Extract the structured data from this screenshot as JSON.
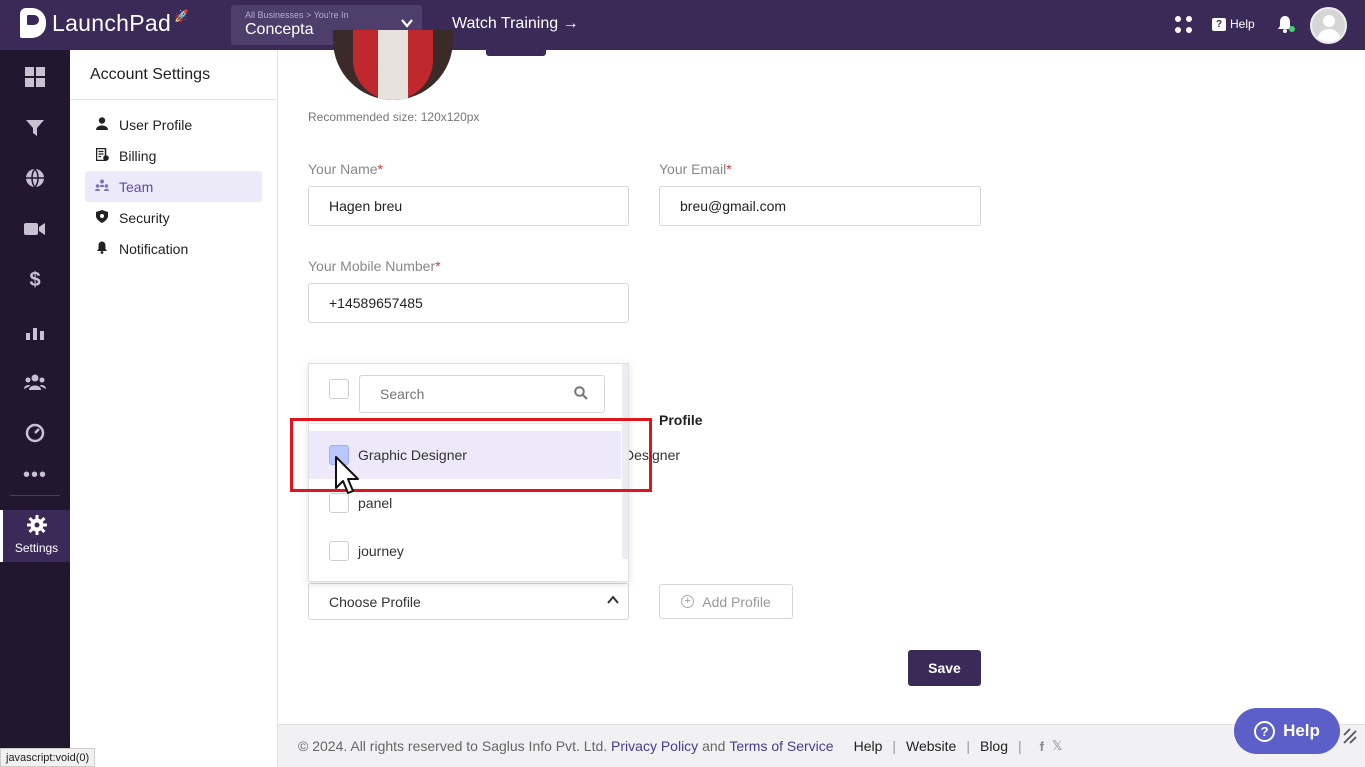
{
  "topbar": {
    "logo_text": "LaunchPad",
    "breadcrumb": "All Businesses > You're In",
    "business_name": "Concepta",
    "watch_training": "Watch Training →",
    "help_label": "Help"
  },
  "rail": {
    "items": [
      "dashboard-icon",
      "funnel-icon",
      "globe-icon",
      "video-icon",
      "dollar-icon",
      "analytics-icon",
      "users-icon",
      "gauge-icon",
      "more-icon"
    ],
    "settings_label": "Settings"
  },
  "settings_nav": {
    "title": "Account Settings",
    "items": [
      {
        "label": "User Profile",
        "icon": "user-icon"
      },
      {
        "label": "Billing",
        "icon": "billing-icon"
      },
      {
        "label": "Team",
        "icon": "team-icon",
        "active": true
      },
      {
        "label": "Security",
        "icon": "shield-icon"
      },
      {
        "label": "Notification",
        "icon": "bell-icon"
      }
    ]
  },
  "form": {
    "recommended_size": "Recommended size: 120x120px",
    "name_label": "Your Name",
    "name_value": "Hagen breu",
    "email_label": "Your Email",
    "email_value": "breu@gmail.com",
    "mobile_label": "Your Mobile Number",
    "mobile_value": "+14589657485",
    "required_mark": "*",
    "profile_heading": "Profile",
    "profile_partial": "Designer",
    "choose_profile": "Choose Profile",
    "add_profile": "Add Profile",
    "save_label": "Save"
  },
  "dropdown": {
    "search_placeholder": "Search",
    "options": [
      {
        "label": "Graphic Designer",
        "hovered": true
      },
      {
        "label": "panel"
      },
      {
        "label": "journey"
      }
    ]
  },
  "footer": {
    "copyright": "©  2024. All rights reserved to Saglus Info Pvt. Ltd.",
    "privacy": "Privacy Policy",
    "and": "and",
    "terms": "Terms of Service",
    "help": "Help",
    "website": "Website",
    "blog": "Blog",
    "separator": "|"
  },
  "help_button": "Help",
  "status_bar": "javascript:void(0)",
  "colors": {
    "topbar": "#3b2a57",
    "rail": "#22172f",
    "accent": "#5b4ba0",
    "help_button": "#5b5fc7",
    "highlight": "#e0141e"
  }
}
